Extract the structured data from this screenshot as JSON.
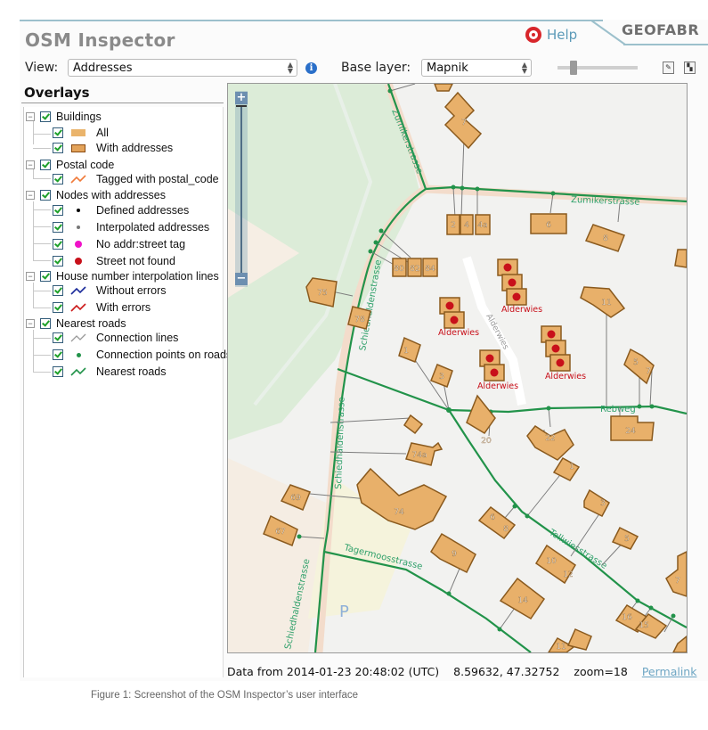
{
  "app": {
    "title": "OSM Inspector",
    "help_label": "Help",
    "brand": "GEOFABR"
  },
  "toolbar": {
    "view_label": "View:",
    "view_value": "Addresses",
    "base_layer_label": "Base layer:",
    "base_layer_value": "Mapnik",
    "opacity_fraction": 0.2
  },
  "overlays": {
    "title": "Overlays",
    "groups": [
      {
        "label": "Buildings",
        "checked": true,
        "items": [
          {
            "label": "All",
            "symbol": "fill-box",
            "checked": true
          },
          {
            "label": "With addresses",
            "symbol": "outlined-box",
            "checked": true
          }
        ]
      },
      {
        "label": "Postal code",
        "checked": true,
        "items": [
          {
            "label": "Tagged with postal_code",
            "symbol": "line-orange",
            "checked": true
          }
        ]
      },
      {
        "label": "Nodes with addresses",
        "checked": true,
        "items": [
          {
            "label": "Defined addresses",
            "symbol": "dot-black",
            "checked": true
          },
          {
            "label": "Interpolated addresses",
            "symbol": "dot-gray",
            "checked": true
          },
          {
            "label": "No addr:street tag",
            "symbol": "dot-magenta",
            "checked": true
          },
          {
            "label": "Street not found",
            "symbol": "dot-red",
            "checked": true
          }
        ]
      },
      {
        "label": "House number interpolation lines",
        "checked": true,
        "items": [
          {
            "label": "Without errors",
            "symbol": "line-blue",
            "checked": true
          },
          {
            "label": "With errors",
            "symbol": "line-red",
            "checked": true
          }
        ]
      },
      {
        "label": "Nearest roads",
        "checked": true,
        "items": [
          {
            "label": "Connection lines",
            "symbol": "line-gray",
            "checked": true
          },
          {
            "label": "Connection points on roads",
            "symbol": "dot-green",
            "checked": true
          },
          {
            "label": "Nearest roads",
            "symbol": "line-green",
            "checked": true
          }
        ]
      }
    ]
  },
  "map": {
    "colors": {
      "building_fill": "#e8b06a",
      "building_stroke": "#8a5a1e",
      "road": "#22934a",
      "road_label": "#2fa06a",
      "connection": "#7d7d7d",
      "error_dot": "#c8101a",
      "error_label": "#c8101a",
      "park": "#dcecd8",
      "background": "#f2f2f0"
    },
    "streets": [
      "Zumikerstrasse",
      "Zumikerstrasse",
      "Schiedhaldenstrasse",
      "Schiedhaldenstrasse",
      "Schiedhaldenstrasse",
      "Rebweg",
      "Tagermoosstrasse",
      "Tollwiesstrasse",
      "Alderwies"
    ],
    "house_numbers": [
      "7",
      "2",
      "4",
      "4a",
      "6",
      "8",
      "80",
      "82",
      "84",
      "75",
      "78",
      "1",
      "3",
      "11",
      "5",
      "7",
      "20",
      "22",
      "24",
      "74a",
      "69",
      "74",
      "67",
      "1",
      "3",
      "6",
      "8",
      "5",
      "7",
      "10",
      "12",
      "9",
      "14",
      "16",
      "15",
      "11"
    ],
    "error_labels": [
      "Alderwies",
      "Alderwies",
      "Alderwies",
      "Alderwies"
    ],
    "zoom_in_label": "+",
    "zoom_out_label": "−"
  },
  "status": {
    "data_from": "Data from 2014-01-23 20:48:02 (UTC)",
    "coords": "8.59632, 47.32752",
    "zoom": "zoom=18",
    "permalink": "Permalink"
  },
  "caption": "Figure 1: Screenshot of the OSM Inspector’s user interface"
}
